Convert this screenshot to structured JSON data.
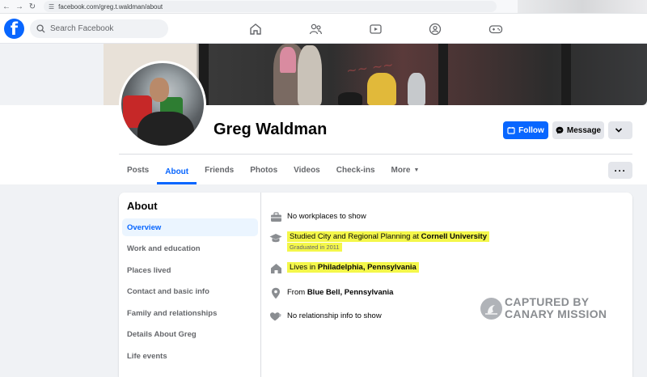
{
  "browser": {
    "url": "facebook.com/greg.t.waldman/about"
  },
  "topnav": {
    "logo": "f",
    "search_placeholder": "Search Facebook",
    "icons": [
      "home-icon",
      "friends-icon",
      "watch-icon",
      "groups-icon",
      "gaming-icon"
    ]
  },
  "profile": {
    "name": "Greg Waldman",
    "follow_label": "Follow",
    "message_label": "Message"
  },
  "tabs": [
    {
      "label": "Posts"
    },
    {
      "label": "About",
      "active": true
    },
    {
      "label": "Friends"
    },
    {
      "label": "Photos"
    },
    {
      "label": "Videos"
    },
    {
      "label": "Check-ins"
    },
    {
      "label": "More"
    }
  ],
  "about": {
    "title": "About",
    "menu": [
      "Overview",
      "Work and education",
      "Places lived",
      "Contact and basic info",
      "Family and relationships",
      "Details About Greg",
      "Life events"
    ],
    "overview": {
      "work": "No workplaces to show",
      "education_prefix": "Studied City and Regional Planning at ",
      "education_school": "Cornell University",
      "education_sub": "Graduated in 2011",
      "lives_prefix": "Lives in ",
      "lives_place": "Philadelphia, Pennsylvania",
      "from_prefix": "From ",
      "from_place": "Blue Bell, Pennsylvania",
      "relationship": "No relationship info to show"
    }
  },
  "watermark": {
    "line1": "CAPTURED BY",
    "line2": "CANARY MISSION"
  },
  "colors": {
    "brand": "#0866ff",
    "highlight": "#f4f74a"
  }
}
